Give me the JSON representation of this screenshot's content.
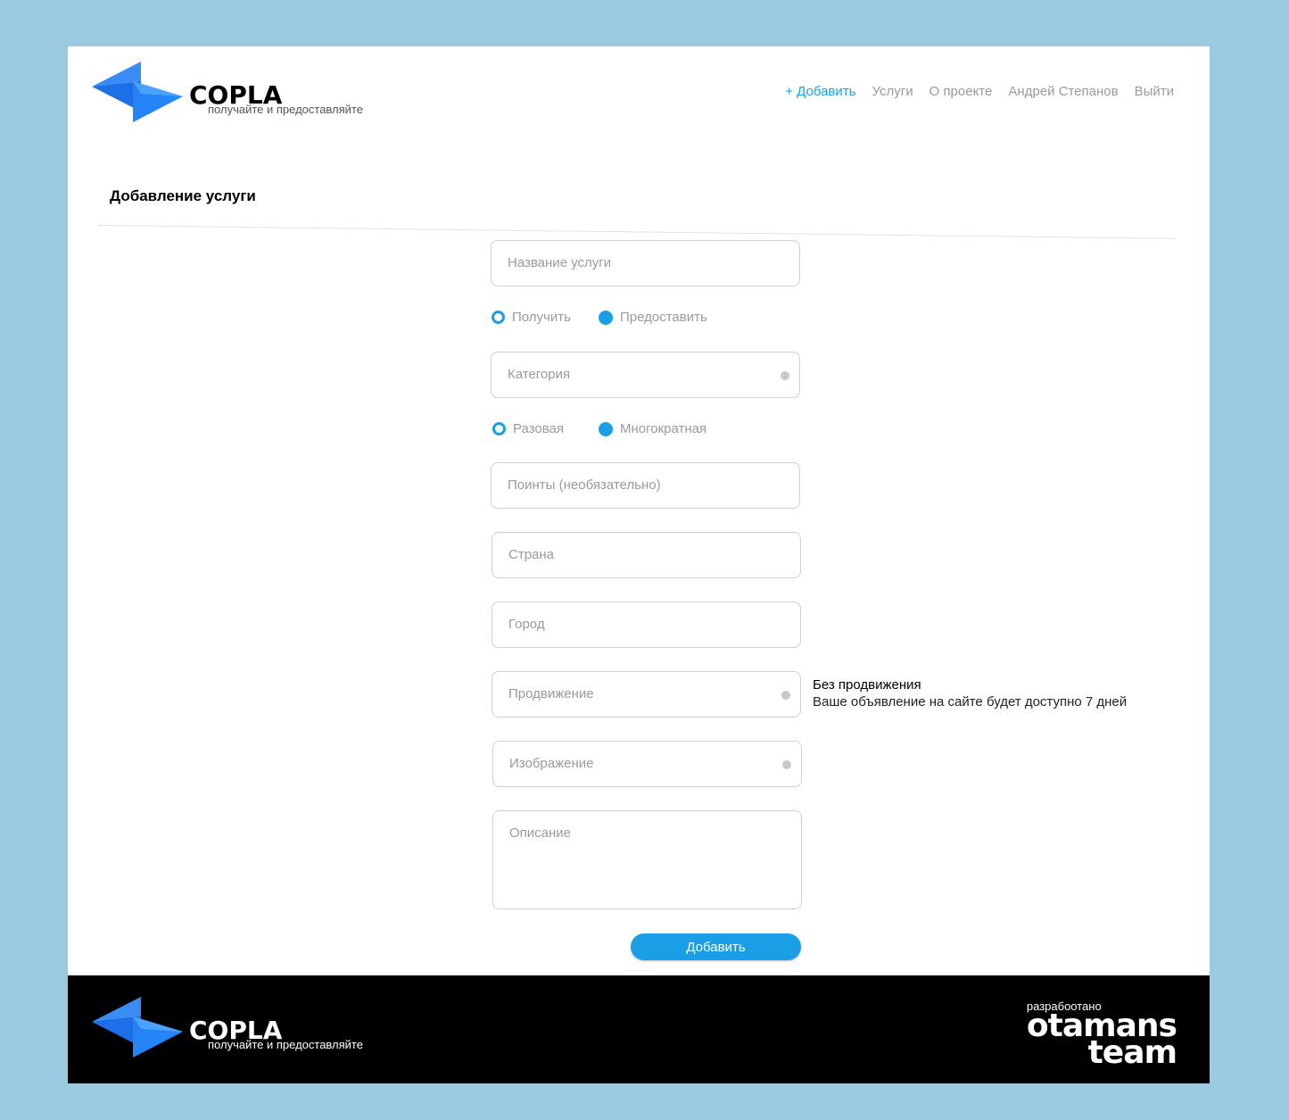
{
  "brand": {
    "name": "COPLA",
    "tagline": "получайте и предоставляйте"
  },
  "nav": {
    "add": "+ Добавить",
    "services": "Услуги",
    "about": "О проекте",
    "user": "Андрей Степанов",
    "logout": "Выйти"
  },
  "page": {
    "title": "Добавление услуги"
  },
  "form": {
    "service_name": "Название услуги",
    "type_options": [
      "Получить",
      "Предоставить"
    ],
    "category": "Категория",
    "frequency_options": [
      "Разовая",
      "Многократная"
    ],
    "points": "Поинты (необязательно)",
    "country": "Страна",
    "city": "Город",
    "promotion": "Продвижение",
    "image": "Изображение",
    "description": "Описание",
    "submit": "Добавить"
  },
  "promotion_info": {
    "title": "Без продвижения",
    "text": "Ваше объявление на сайте будет доступно 7 дней"
  },
  "footer": {
    "developed_by": "разрабоотано",
    "dev_name_line1": "otamans",
    "dev_name_line2": "team"
  },
  "colors": {
    "accent": "#1a9fe6",
    "background": "#9ac9e0",
    "footer": "#000000"
  }
}
